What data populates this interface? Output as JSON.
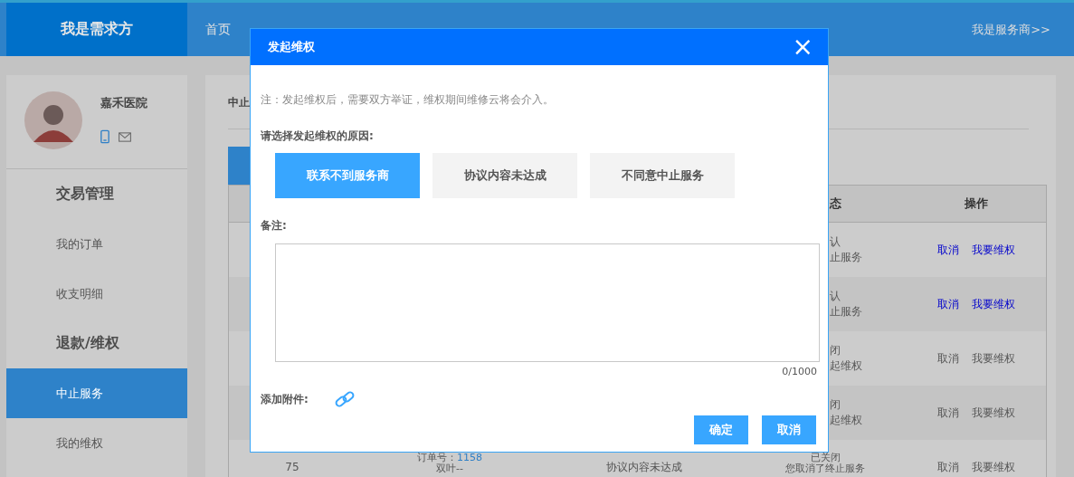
{
  "header": {
    "brand": "我是需求方",
    "nav": [
      {
        "label": "首页",
        "selected": false
      }
    ],
    "switch_link": "我是服务商>>"
  },
  "profile": {
    "name": "嘉禾医院"
  },
  "sidebar": {
    "items": [
      {
        "kind": "section",
        "label": "交易管理"
      },
      {
        "kind": "link",
        "label": "我的订单",
        "selected": false
      },
      {
        "kind": "link",
        "label": "收支明细",
        "selected": false
      },
      {
        "kind": "section",
        "label": "退款/维权"
      },
      {
        "kind": "link",
        "label": "中止服务",
        "selected": true
      },
      {
        "kind": "link",
        "label": "我的维权",
        "selected": false
      }
    ]
  },
  "content": {
    "heading": "中止",
    "table": {
      "columns": [
        "态",
        "操作"
      ],
      "rows": [
        {
          "status": [
            "认",
            "止服务"
          ],
          "status_clipped": true,
          "actions": [
            {
              "label": "取消",
              "enabled": true
            },
            {
              "label": "我要维权",
              "enabled": true
            }
          ]
        },
        {
          "status": [
            "认",
            "止服务"
          ],
          "status_clipped": true,
          "actions": [
            {
              "label": "取消",
              "enabled": true
            },
            {
              "label": "我要维权",
              "enabled": true
            }
          ]
        },
        {
          "status": [
            "闭",
            "起维权"
          ],
          "status_clipped": true,
          "actions": [
            {
              "label": "取消",
              "enabled": false
            },
            {
              "label": "我要维权",
              "enabled": false
            }
          ]
        },
        {
          "status": [
            "闭",
            "起维权"
          ],
          "status_clipped": true,
          "actions": [
            {
              "label": "取消",
              "enabled": false
            },
            {
              "label": "我要维权",
              "enabled": false
            }
          ]
        },
        {
          "id": "75",
          "order_label": "订单号：",
          "order_no": "1158",
          "buyer": "双叶--",
          "reason": "协议内容未达成",
          "status": [
            "已关闭",
            "您取消了终止服务"
          ],
          "status_clipped": false,
          "actions": [
            {
              "label": "取消",
              "enabled": false
            },
            {
              "label": "我要维权",
              "enabled": false
            }
          ]
        }
      ]
    }
  },
  "dialog": {
    "title": "发起维权",
    "close": "×",
    "note": "注：发起维权后，需要双方举证，维权期间维修云将会介入。",
    "reason_label": "请选择发起维权的原因:",
    "reasons": [
      {
        "label": "联系不到服务商",
        "selected": true
      },
      {
        "label": "协议内容未达成",
        "selected": false
      },
      {
        "label": "不同意中止服务",
        "selected": false
      }
    ],
    "remark_label": "备注:",
    "remark_counter": "0/1000",
    "attach_label": "添加附件:",
    "buttons": [
      {
        "label": "确定"
      },
      {
        "label": "取消"
      }
    ]
  }
}
